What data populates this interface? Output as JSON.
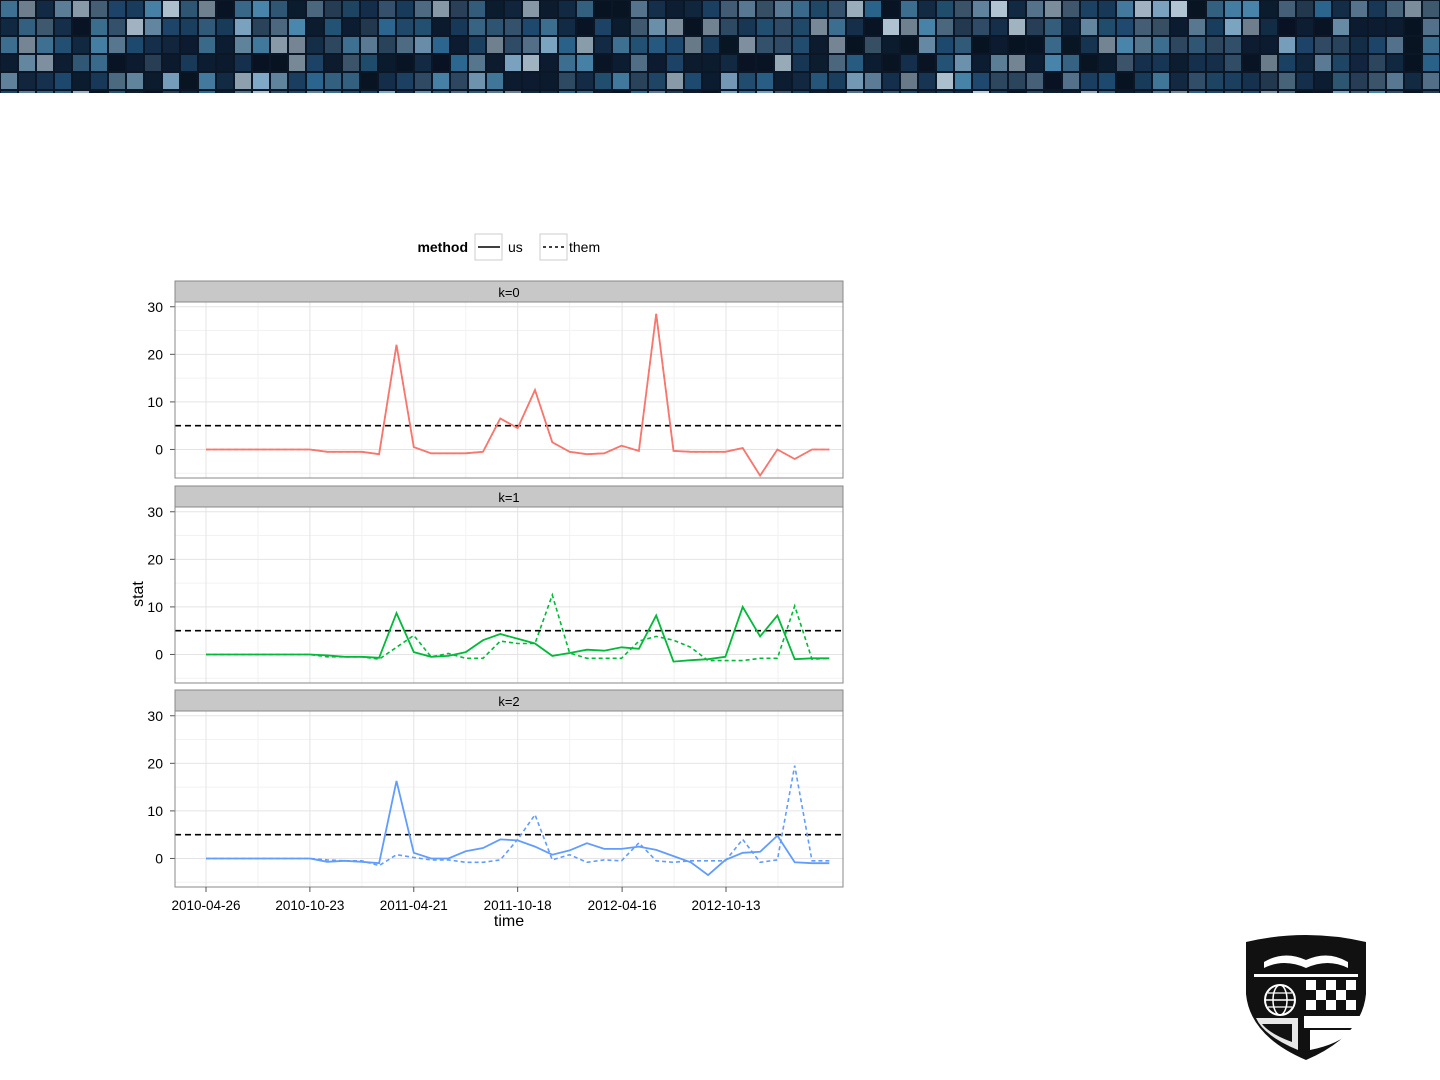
{
  "banner": {
    "colors": [
      "#0d1e33",
      "#16324f",
      "#1f4a70",
      "#2d6891",
      "#4a87ad",
      "#7fa9c6",
      "#b6cad8",
      "#081322",
      "#35526d",
      "#5c7d96"
    ]
  },
  "logo": {
    "icon": "university-shield-icon",
    "color": "#111111"
  },
  "chart_data": {
    "type": "line",
    "legend": {
      "title": "method",
      "entries": [
        {
          "label": "us",
          "style": "solid"
        },
        {
          "label": "them",
          "style": "dashed"
        }
      ],
      "position": "top"
    },
    "xlabel": "time",
    "ylabel": "stat",
    "x_ticks": [
      "2010-04-26",
      "2010-10-23",
      "2011-04-21",
      "2011-10-18",
      "2012-04-16",
      "2012-10-13"
    ],
    "ylim": [
      -6,
      31
    ],
    "y_ticks": [
      0,
      10,
      20,
      30
    ],
    "threshold": 5,
    "grid": true,
    "panel_label_bg": "#c8c8c8",
    "x": [
      "2010-04-26",
      "2010-05-26",
      "2010-06-25",
      "2010-07-25",
      "2010-08-24",
      "2010-09-23",
      "2010-10-23",
      "2010-11-22",
      "2010-12-22",
      "2011-01-21",
      "2011-02-20",
      "2011-03-22",
      "2011-04-21",
      "2011-05-21",
      "2011-06-20",
      "2011-07-20",
      "2011-08-19",
      "2011-09-18",
      "2011-10-18",
      "2011-11-17",
      "2011-12-17",
      "2012-01-16",
      "2012-02-15",
      "2012-03-16",
      "2012-04-15",
      "2012-05-15",
      "2012-06-14",
      "2012-07-14",
      "2012-08-13",
      "2012-09-12",
      "2012-10-12",
      "2012-11-11",
      "2012-12-11",
      "2013-01-10",
      "2013-02-09",
      "2013-03-11",
      "2013-04-10"
    ],
    "panels": [
      {
        "label": "k=0",
        "color": "#f8766d",
        "us": [
          0,
          0,
          0,
          0,
          0,
          0,
          0,
          -0.5,
          -0.5,
          -0.5,
          -1,
          22,
          0.5,
          -0.8,
          -0.8,
          -0.8,
          -0.5,
          6.5,
          4.5,
          12.5,
          1.5,
          -0.5,
          -1,
          -0.8,
          0.8,
          -0.3,
          28.5,
          -0.3,
          -0.5,
          -0.5,
          -0.5,
          0.3,
          -5.5,
          0,
          -2,
          0,
          0
        ],
        "them": [
          0,
          0,
          0,
          0,
          0,
          0,
          0,
          -0.5,
          -0.5,
          -0.5,
          -1,
          22,
          0.5,
          -0.8,
          -0.8,
          -0.8,
          -0.5,
          6.5,
          4.5,
          12.5,
          1.5,
          -0.5,
          -1,
          -0.8,
          0.8,
          -0.3,
          28.5,
          -0.3,
          -0.5,
          -0.5,
          -0.5,
          0.3,
          -5.5,
          0,
          -2,
          0,
          0
        ]
      },
      {
        "label": "k=1",
        "color": "#00ba38",
        "us": [
          0,
          0,
          0,
          0,
          0,
          0,
          0,
          -0.2,
          -0.5,
          -0.5,
          -0.7,
          8.7,
          0.5,
          -0.5,
          -0.3,
          0.5,
          3,
          4.3,
          3.3,
          2.3,
          -0.3,
          0.3,
          1,
          0.8,
          1.5,
          1.2,
          8.2,
          -1.5,
          -1.2,
          -1,
          -0.5,
          10,
          3.8,
          8.2,
          -1,
          -0.8,
          -0.8
        ],
        "them": [
          0,
          0,
          0,
          0,
          0,
          0,
          0,
          -0.5,
          -0.5,
          -0.5,
          -1,
          1.5,
          4,
          -0.5,
          0.2,
          -0.8,
          -0.8,
          2.8,
          2.3,
          2.3,
          12.5,
          0.3,
          -0.8,
          -0.8,
          -0.8,
          2.8,
          3.8,
          3,
          1.5,
          -1.3,
          -1.3,
          -1.3,
          -0.8,
          -0.8,
          10.2,
          -1,
          -0.8
        ]
      },
      {
        "label": "k=2",
        "color": "#619cff",
        "us": [
          0,
          0,
          0,
          0,
          0,
          0,
          0,
          -0.7,
          -0.5,
          -0.7,
          -1,
          16.3,
          1.2,
          0,
          0,
          1.5,
          2.2,
          4,
          3.8,
          2.5,
          0.8,
          1.7,
          3.2,
          2,
          2,
          2.5,
          1.8,
          0.5,
          -0.8,
          -3.5,
          -0.3,
          1.2,
          1.4,
          4.8,
          -0.8,
          -1,
          -1
        ],
        "them": [
          0,
          0,
          0,
          0,
          0,
          0,
          0,
          -0.3,
          -0.5,
          -0.5,
          -1.5,
          0.8,
          0.2,
          -0.3,
          -0.3,
          -0.8,
          -0.8,
          -0.3,
          4,
          9.2,
          -0.3,
          0.8,
          -0.8,
          -0.3,
          -0.5,
          3.3,
          -0.5,
          -0.8,
          -0.5,
          -0.5,
          -0.5,
          4,
          -0.8,
          -0.3,
          19.5,
          -0.5,
          -0.5
        ]
      }
    ]
  }
}
